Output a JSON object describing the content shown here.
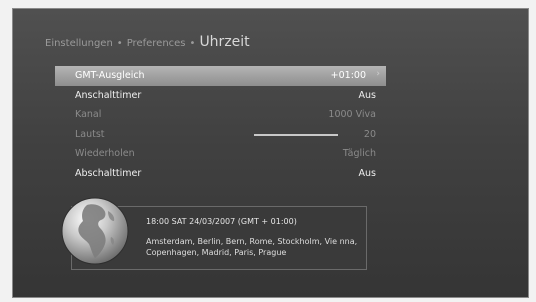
{
  "breadcrumb": {
    "items": [
      "Einstellungen",
      "Preferences"
    ],
    "separator": "•",
    "current": "Uhrzeit"
  },
  "menu": {
    "rows": [
      {
        "label": "GMT-Ausgleich",
        "value": "+01:00",
        "state": "selected"
      },
      {
        "label": "Anschalttimer",
        "value": "Aus",
        "state": "enabled"
      },
      {
        "label": "Kanal",
        "value": "1000 Viva",
        "state": "disabled"
      },
      {
        "label": "Lautst",
        "value": "20",
        "state": "disabled"
      },
      {
        "label": "Wiederholen",
        "value": "Täglich",
        "state": "disabled"
      },
      {
        "label": "Abschalttimer",
        "value": "Aus",
        "state": "enabled"
      }
    ]
  },
  "info": {
    "time": "18:00 SAT 24/03/2007 (GMT + 01:00)",
    "cities": "Amsterdam, Berlin, Bern, Rome, Stockholm, Vie nna, Copenhagen, Madrid, Paris, Prague"
  },
  "icons": {
    "globe": "globe-icon",
    "arrow": "chevron-right-icon"
  }
}
